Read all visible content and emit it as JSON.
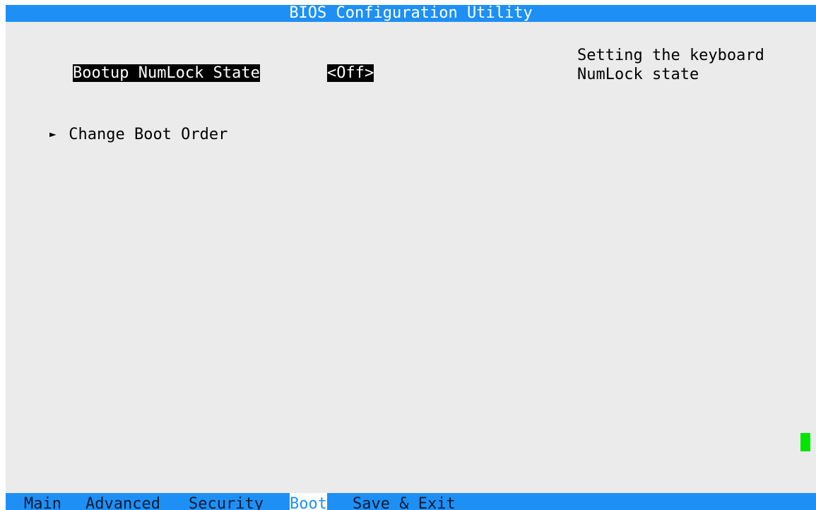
{
  "title": "BIOS Configuration Utility",
  "setting": {
    "label": "Bootup NumLock State",
    "value": "<Off>"
  },
  "help_text": "Setting the keyboard\nNumLock state",
  "submenu": {
    "arrow": "►",
    "label": "Change Boot Order"
  },
  "tabs": [
    {
      "label": "Main",
      "active": false
    },
    {
      "label": "Advanced",
      "active": false
    },
    {
      "label": "Security",
      "active": false
    },
    {
      "label": "Boot",
      "active": true
    },
    {
      "label": "Save & Exit",
      "active": false
    }
  ],
  "colors": {
    "bar_blue": "#1e90f5",
    "background": "#ebebeb",
    "highlight": "#000000",
    "cursor": "#00e600"
  }
}
